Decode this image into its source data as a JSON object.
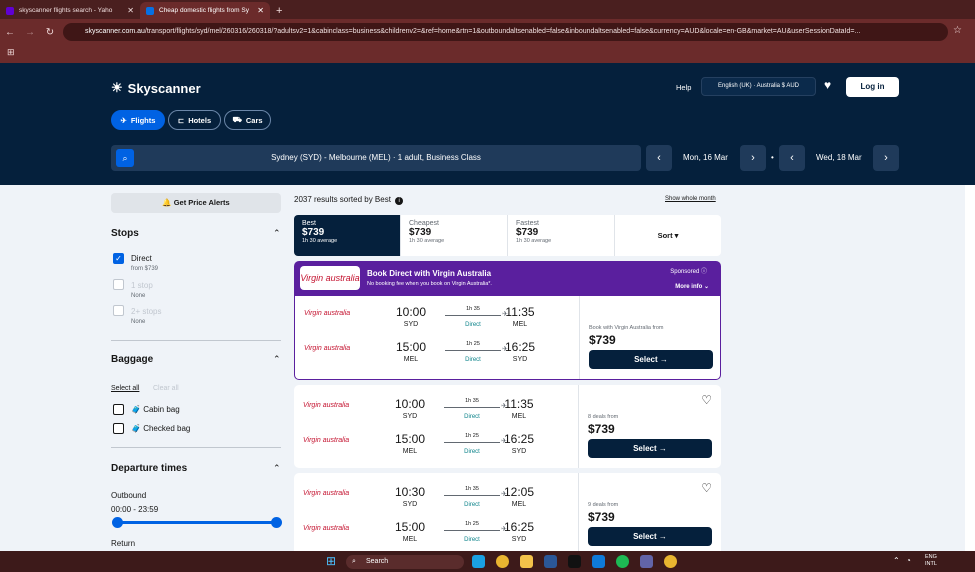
{
  "browser": {
    "tabs": [
      {
        "title": "skyscanner flights search - Yaho",
        "active": false
      },
      {
        "title": "Cheap domestic flights from Sy",
        "active": true
      }
    ],
    "url_host": "skyscanner.com.au",
    "url_path": "/transport/flights/syd/mel/260316/260318/?adultsv2=1&cabinclass=business&childrenv2=&ref=home&rtn=1&outboundaltsenabled=false&inboundaltsenabled=false&currency=AUD&locale=en-GB&market=AU&userSessionDataId=..."
  },
  "header": {
    "brand": "Skyscanner",
    "help": "Help",
    "locale": "English (UK)  ·  Australia  $ AUD",
    "login": "Log in",
    "pills": [
      "Flights",
      "Hotels",
      "Cars"
    ]
  },
  "search": {
    "summary": "Sydney (SYD) - Melbourne (MEL)  ·  1 adult, Business Class",
    "depart_date": "Mon, 16 Mar",
    "return_date": "Wed, 18 Mar"
  },
  "sidebar": {
    "price_alerts": "Get Price Alerts",
    "stops_title": "Stops",
    "stops": [
      {
        "label": "Direct",
        "sub": "from $739",
        "checked": true,
        "disabled": false
      },
      {
        "label": "1 stop",
        "sub": "None",
        "checked": false,
        "disabled": true
      },
      {
        "label": "2+ stops",
        "sub": "None",
        "checked": false,
        "disabled": true
      }
    ],
    "baggage_title": "Baggage",
    "select_all": "Select all",
    "clear_all": "Clear all",
    "bags": [
      "Cabin bag",
      "Checked bag"
    ],
    "departure_title": "Departure times",
    "outbound_label": "Outbound",
    "outbound_range": "00:00 - 23:59",
    "return_label": "Return"
  },
  "results": {
    "summary": "2037 results sorted by Best",
    "show_month": "Show whole month",
    "sort_tabs": [
      {
        "label": "Best",
        "price": "$739",
        "dur": "1h 30 average"
      },
      {
        "label": "Cheapest",
        "price": "$739",
        "dur": "1h 30 average"
      },
      {
        "label": "Fastest",
        "price": "$739",
        "dur": "1h 30 average"
      }
    ],
    "sort_label": "Sort",
    "sponsor": {
      "logo": "Virgin australia",
      "title": "Book Direct with Virgin Australia",
      "subtitle": "No booking fee when you book on Virgin Australia*.",
      "badge": "Sponsored",
      "more": "More info"
    },
    "cards": [
      {
        "deals": "Book with Virgin Australia from",
        "price": "$739",
        "select": "Select",
        "legs": [
          {
            "airline": "Virgin australia",
            "dep": "10:00",
            "dep_ap": "SYD",
            "dur": "1h 35",
            "stops": "Direct",
            "arr": "11:35",
            "arr_ap": "MEL"
          },
          {
            "airline": "Virgin australia",
            "dep": "15:00",
            "dep_ap": "MEL",
            "dur": "1h 25",
            "stops": "Direct",
            "arr": "16:25",
            "arr_ap": "SYD"
          }
        ]
      },
      {
        "deals": "8 deals from",
        "price": "$739",
        "select": "Select",
        "legs": [
          {
            "airline": "Virgin australia",
            "dep": "10:00",
            "dep_ap": "SYD",
            "dur": "1h 35",
            "stops": "Direct",
            "arr": "11:35",
            "arr_ap": "MEL"
          },
          {
            "airline": "Virgin australia",
            "dep": "15:00",
            "dep_ap": "MEL",
            "dur": "1h 25",
            "stops": "Direct",
            "arr": "16:25",
            "arr_ap": "SYD"
          }
        ]
      },
      {
        "deals": "9 deals from",
        "price": "$739",
        "select": "Select",
        "legs": [
          {
            "airline": "Virgin australia",
            "dep": "10:30",
            "dep_ap": "SYD",
            "dur": "1h 35",
            "stops": "Direct",
            "arr": "12:05",
            "arr_ap": "MEL"
          },
          {
            "airline": "Virgin australia",
            "dep": "15:00",
            "dep_ap": "MEL",
            "dur": "1h 25",
            "stops": "Direct",
            "arr": "16:25",
            "arr_ap": "SYD"
          }
        ]
      }
    ]
  },
  "taskbar": {
    "search": "Search",
    "lang": "ENG",
    "region": "INTL"
  }
}
